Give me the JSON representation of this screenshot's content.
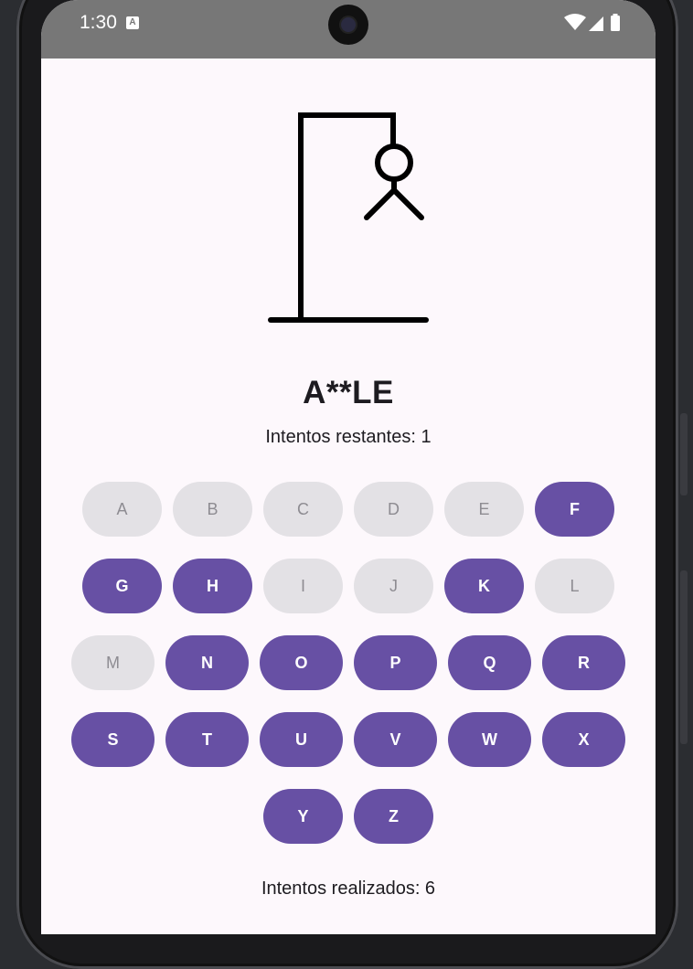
{
  "status_bar": {
    "time": "1:30",
    "notification_icon": "a-icon",
    "icons": [
      "wifi-icon",
      "signal-icon",
      "battery-icon"
    ]
  },
  "game": {
    "word": "A**LE",
    "remaining_label": "Intentos restantes: 1",
    "attempts_label": "Intentos realizados: 6",
    "hangman_parts_shown": [
      "head",
      "body",
      "arms"
    ]
  },
  "keyboard": {
    "rows": [
      [
        {
          "label": "A",
          "disabled": true
        },
        {
          "label": "B",
          "disabled": true
        },
        {
          "label": "C",
          "disabled": true
        },
        {
          "label": "D",
          "disabled": true
        },
        {
          "label": "E",
          "disabled": true
        },
        {
          "label": "F",
          "disabled": false
        }
      ],
      [
        {
          "label": "G",
          "disabled": false
        },
        {
          "label": "H",
          "disabled": false
        },
        {
          "label": "I",
          "disabled": true
        },
        {
          "label": "J",
          "disabled": true
        },
        {
          "label": "K",
          "disabled": false
        },
        {
          "label": "L",
          "disabled": true
        }
      ],
      [
        {
          "label": "M",
          "disabled": true
        },
        {
          "label": "N",
          "disabled": false
        },
        {
          "label": "O",
          "disabled": false
        },
        {
          "label": "P",
          "disabled": false
        },
        {
          "label": "Q",
          "disabled": false
        },
        {
          "label": "R",
          "disabled": false
        }
      ],
      [
        {
          "label": "S",
          "disabled": false
        },
        {
          "label": "T",
          "disabled": false
        },
        {
          "label": "U",
          "disabled": false
        },
        {
          "label": "V",
          "disabled": false
        },
        {
          "label": "W",
          "disabled": false
        },
        {
          "label": "X",
          "disabled": false
        }
      ],
      [
        {
          "label": "Y",
          "disabled": false
        },
        {
          "label": "Z",
          "disabled": false
        }
      ]
    ]
  },
  "colors": {
    "accent": "#6750a4",
    "disabled_bg": "#e3e1e5",
    "disabled_text": "#8e8c92",
    "background": "#fdf8fc",
    "status_bar": "#777777"
  }
}
